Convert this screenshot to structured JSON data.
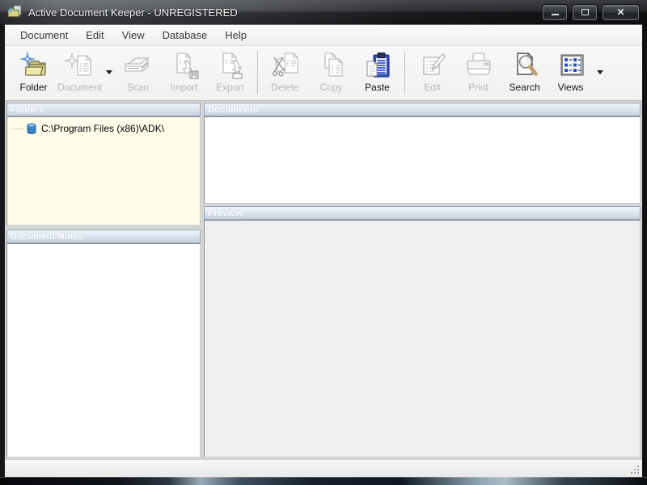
{
  "window": {
    "title": "Active Document Keeper - UNREGISTERED",
    "controls": [
      "minimize",
      "maximize",
      "close"
    ]
  },
  "menu": {
    "items": [
      "Document",
      "Edit",
      "View",
      "Database",
      "Help"
    ]
  },
  "toolbar": {
    "items": [
      {
        "type": "button",
        "label": "Folder",
        "icon": "new-folder-icon",
        "enabled": true,
        "dropdown": false
      },
      {
        "type": "button",
        "label": "Document",
        "icon": "new-document-icon",
        "enabled": false,
        "dropdown": true
      },
      {
        "type": "button",
        "label": "Scan",
        "icon": "scanner-icon",
        "enabled": false,
        "dropdown": false
      },
      {
        "type": "button",
        "label": "Import",
        "icon": "import-icon",
        "enabled": false,
        "dropdown": false
      },
      {
        "type": "button",
        "label": "Export",
        "icon": "export-icon",
        "enabled": false,
        "dropdown": false
      },
      {
        "type": "separator"
      },
      {
        "type": "button",
        "label": "Delete",
        "icon": "delete-icon",
        "enabled": false,
        "dropdown": false
      },
      {
        "type": "button",
        "label": "Copy",
        "icon": "copy-icon",
        "enabled": false,
        "dropdown": false
      },
      {
        "type": "button",
        "label": "Paste",
        "icon": "paste-icon",
        "enabled": true,
        "dropdown": false
      },
      {
        "type": "separator"
      },
      {
        "type": "button",
        "label": "Edit",
        "icon": "edit-icon",
        "enabled": false,
        "dropdown": false
      },
      {
        "type": "button",
        "label": "Print",
        "icon": "print-icon",
        "enabled": false,
        "dropdown": false
      },
      {
        "type": "button",
        "label": "Search",
        "icon": "search-icon",
        "enabled": true,
        "dropdown": false
      },
      {
        "type": "button",
        "label": "Views",
        "icon": "views-icon",
        "enabled": true,
        "dropdown": true
      }
    ]
  },
  "panels": {
    "folders": {
      "title": "Folders",
      "items": [
        {
          "label": "C:\\Program Files (x86)\\ADK\\",
          "icon": "database-icon"
        }
      ]
    },
    "documents": {
      "title": "Documents",
      "items": []
    },
    "preview": {
      "title": "Preview"
    },
    "notes": {
      "title": "Document Notes",
      "text": ""
    }
  },
  "colors": {
    "panel_header_top": "#eff4fa",
    "panel_header_bottom": "#c2d0de",
    "folders_background": "#fdfdea",
    "toolbar_disabled_text": "#b9b9b9",
    "paste_icon_blue": "#3a57c8",
    "views_icon_blue": "#2a4ec8"
  }
}
